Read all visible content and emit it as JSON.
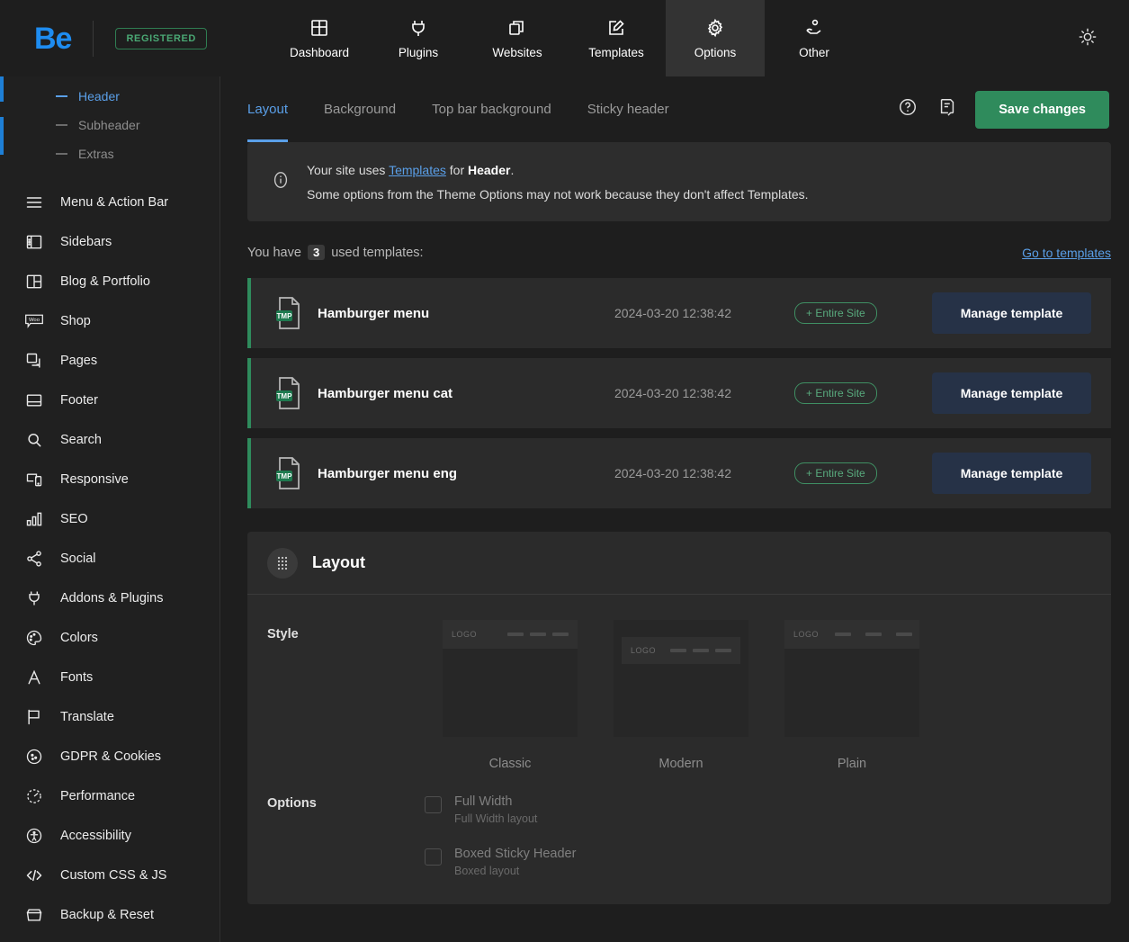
{
  "topbar": {
    "logo": "Be",
    "registered_badge": "REGISTERED",
    "nav": [
      {
        "label": "Dashboard",
        "icon": "dashboard-icon",
        "active": false
      },
      {
        "label": "Plugins",
        "icon": "plug-icon",
        "active": false
      },
      {
        "label": "Websites",
        "icon": "copy-icon",
        "active": false
      },
      {
        "label": "Templates",
        "icon": "edit-doc-icon",
        "active": false
      },
      {
        "label": "Options",
        "icon": "gear-icon",
        "active": true
      },
      {
        "label": "Other",
        "icon": "hand-user-icon",
        "active": false
      }
    ],
    "theme_toggle_icon": "sun-icon"
  },
  "sidebar": {
    "sub_items": [
      {
        "label": "Header",
        "active": true
      },
      {
        "label": "Subheader",
        "active": false
      },
      {
        "label": "Extras",
        "active": false
      }
    ],
    "items": [
      {
        "label": "Menu & Action Bar",
        "icon": "hamburger-icon"
      },
      {
        "label": "Sidebars",
        "icon": "sidebar-icon"
      },
      {
        "label": "Blog & Portfolio",
        "icon": "columns-icon"
      },
      {
        "label": "Shop",
        "icon": "woo-icon"
      },
      {
        "label": "Pages",
        "icon": "pages-icon"
      },
      {
        "label": "Footer",
        "icon": "footer-icon"
      },
      {
        "label": "Search",
        "icon": "search-icon"
      },
      {
        "label": "Responsive",
        "icon": "responsive-icon"
      },
      {
        "label": "SEO",
        "icon": "bar-chart-icon"
      },
      {
        "label": "Social",
        "icon": "share-icon"
      },
      {
        "label": "Addons & Plugins",
        "icon": "plug-icon"
      },
      {
        "label": "Colors",
        "icon": "palette-icon"
      },
      {
        "label": "Fonts",
        "icon": "letter-a-icon"
      },
      {
        "label": "Translate",
        "icon": "flag-icon"
      },
      {
        "label": "GDPR & Cookies",
        "icon": "cookie-icon"
      },
      {
        "label": "Performance",
        "icon": "gauge-icon"
      },
      {
        "label": "Accessibility",
        "icon": "accessibility-icon"
      },
      {
        "label": "Custom CSS & JS",
        "icon": "code-icon"
      },
      {
        "label": "Backup & Reset",
        "icon": "archive-icon"
      }
    ]
  },
  "tabs": [
    {
      "label": "Layout",
      "active": true
    },
    {
      "label": "Background",
      "active": false
    },
    {
      "label": "Top bar background",
      "active": false
    },
    {
      "label": "Sticky header",
      "active": false
    }
  ],
  "toolbar": {
    "help_icon": "question-circle-icon",
    "notes_icon": "note-icon",
    "save_label": "Save changes"
  },
  "notice": {
    "icon": "info-icon",
    "line1_pre": "Your site uses ",
    "line1_link": "Templates",
    "line1_mid": " for ",
    "line1_bold": "Header",
    "line1_post": ".",
    "line2": "Some options from the Theme Options may not work because they don't affect Templates."
  },
  "templates_section": {
    "used_pre": "You have",
    "used_count": "3",
    "used_post": "used templates:",
    "goto_link": "Go to templates",
    "rows": [
      {
        "icon_label": "TMP",
        "name": "Hamburger menu",
        "date": "2024-03-20 12:38:42",
        "badge": "+ Entire Site",
        "button": "Manage template"
      },
      {
        "icon_label": "TMP",
        "name": "Hamburger menu cat",
        "date": "2024-03-20 12:38:42",
        "badge": "+ Entire Site",
        "button": "Manage template"
      },
      {
        "icon_label": "TMP",
        "name": "Hamburger menu eng",
        "date": "2024-03-20 12:38:42",
        "badge": "+ Entire Site",
        "button": "Manage template"
      }
    ]
  },
  "layout_panel": {
    "drag_icon": "drag-grid-icon",
    "title": "Layout",
    "style_label": "Style",
    "styles": [
      {
        "caption": "Classic",
        "logo": "LOGO"
      },
      {
        "caption": "Modern",
        "logo": "LOGO"
      },
      {
        "caption": "Plain",
        "logo": "LOGO"
      }
    ],
    "options_label": "Options",
    "options": [
      {
        "title": "Full Width",
        "sub": "Full Width layout",
        "checked": false
      },
      {
        "title": "Boxed Sticky Header",
        "sub": "Boxed layout",
        "checked": false
      }
    ]
  },
  "colors": {
    "accent_blue": "#5a9fe8",
    "brand_blue": "#1e8cf0",
    "green": "#2f8b5c",
    "panel": "#2b2b2b",
    "background": "#1e1e1e"
  }
}
